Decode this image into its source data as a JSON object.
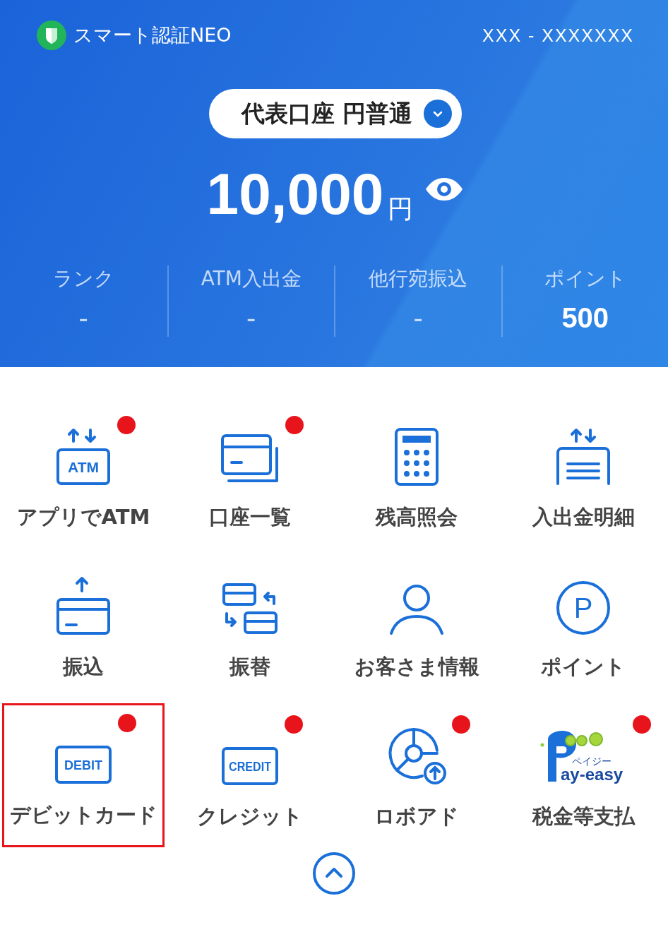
{
  "header": {
    "app_name": "スマート認証NEO",
    "account_number": "XXX - XXXXXXX"
  },
  "account_selector": {
    "label": "代表口座 円普通"
  },
  "balance": {
    "amount": "10,000",
    "unit": "円"
  },
  "stats": [
    {
      "label": "ランク",
      "value": "-"
    },
    {
      "label": "ATM入出金",
      "value": "-"
    },
    {
      "label": "他行宛振込",
      "value": "-"
    },
    {
      "label": "ポイント",
      "value": "500"
    }
  ],
  "menu": [
    {
      "label": "アプリでATM",
      "kind": "atm",
      "icon_text": "ATM",
      "badge": true,
      "highlighted": false
    },
    {
      "label": "口座一覧",
      "kind": "cards",
      "badge": true,
      "highlighted": false
    },
    {
      "label": "残高照会",
      "kind": "calculator",
      "badge": false,
      "highlighted": false
    },
    {
      "label": "入出金明細",
      "kind": "statement",
      "badge": false,
      "highlighted": false
    },
    {
      "label": "振込",
      "kind": "transfer",
      "badge": false,
      "highlighted": false
    },
    {
      "label": "振替",
      "kind": "swap",
      "badge": false,
      "highlighted": false
    },
    {
      "label": "お客さま情報",
      "kind": "person",
      "badge": false,
      "highlighted": false
    },
    {
      "label": "ポイント",
      "kind": "point",
      "icon_text": "P",
      "badge": false,
      "highlighted": false
    },
    {
      "label": "デビットカード",
      "kind": "labelcard",
      "icon_text": "DEBIT",
      "badge": true,
      "highlighted": true
    },
    {
      "label": "クレジット",
      "kind": "labelcard",
      "icon_text": "CREDIT",
      "badge": true,
      "highlighted": false
    },
    {
      "label": "ロボアド",
      "kind": "robo",
      "badge": true,
      "highlighted": false
    },
    {
      "label": "税金等支払",
      "kind": "payeasy",
      "icon_text": "ay-easy",
      "icon_subtext": "ペイジー",
      "badge": true,
      "highlighted": false
    }
  ]
}
